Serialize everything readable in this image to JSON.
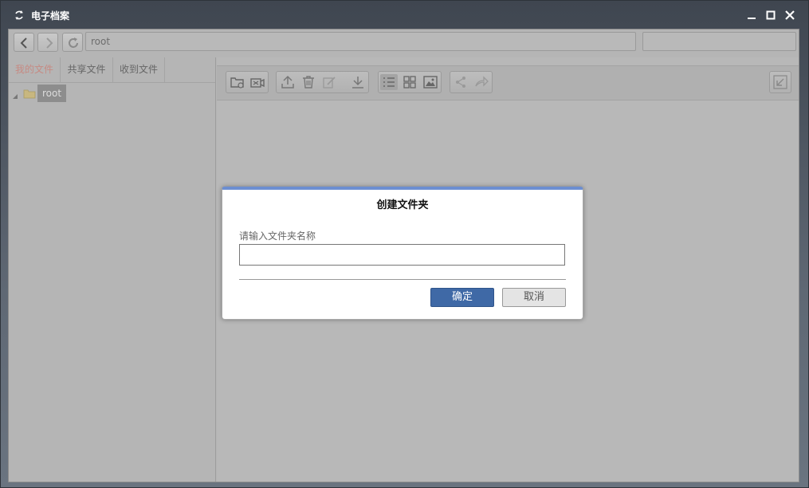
{
  "window": {
    "title": "电子档案",
    "controls": [
      "minimize-icon",
      "maximize-icon",
      "close-icon"
    ]
  },
  "navbar": {
    "address": "root",
    "search_value": ""
  },
  "sidebar": {
    "tabs": [
      {
        "label": "我的文件",
        "active": true
      },
      {
        "label": "共享文件",
        "active": false
      },
      {
        "label": "收到文件",
        "active": false
      }
    ],
    "tree": [
      {
        "label": "root",
        "selected": true
      }
    ]
  },
  "toolbar": {
    "buttons": [
      "new-folder-icon",
      "upload-video-icon",
      "upload-icon",
      "delete-icon",
      "edit-icon",
      "download-icon",
      "list-view-icon",
      "grid-view-icon",
      "image-view-icon",
      "share-icon",
      "forward-icon",
      "export-icon"
    ]
  },
  "dialog": {
    "title": "创建文件夹",
    "label": "请输入文件夹名称",
    "input_value": "",
    "ok_label": "确定",
    "cancel_label": "取消",
    "accent_color": "#6c8ed1",
    "ok_color": "#3f69a6"
  }
}
